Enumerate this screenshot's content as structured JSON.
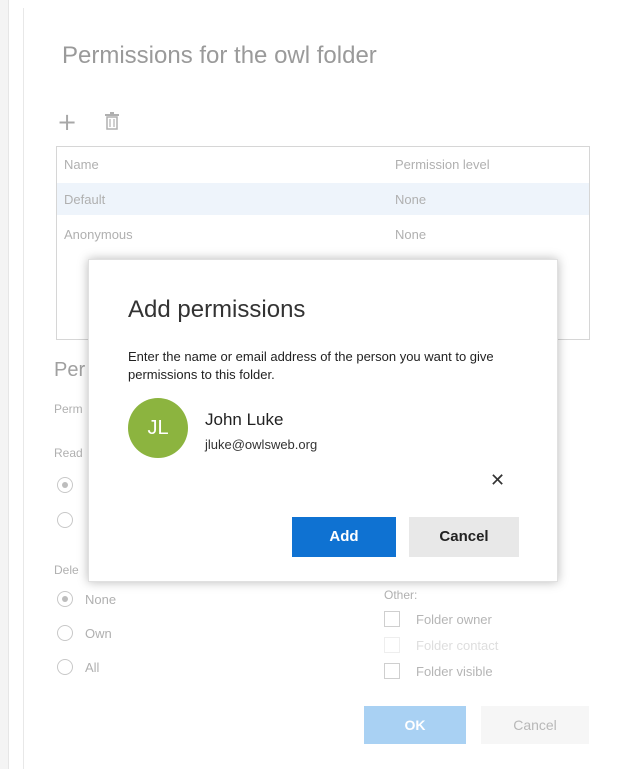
{
  "panel": {
    "title": "Permissions for the owl folder",
    "toolbar": {
      "add_icon": "plus-icon",
      "delete_icon": "trash-icon"
    },
    "table": {
      "headers": [
        "Name",
        "Permission level"
      ],
      "rows": [
        {
          "name": "Default",
          "level": "None",
          "selected": true
        },
        {
          "name": "Anonymous",
          "level": "None",
          "selected": false
        }
      ]
    },
    "section_heading": "Per",
    "permission_label": "Perm",
    "read_label": "Read",
    "delete_label": "Dele",
    "delete_options": [
      "None",
      "Own",
      "All"
    ],
    "delete_selected": "None",
    "other": {
      "label": "Other:",
      "items": [
        "Folder owner",
        "Folder contact",
        "Folder visible"
      ]
    },
    "ok_label": "OK",
    "cancel_label": "Cancel"
  },
  "dialog": {
    "title": "Add permissions",
    "description": "Enter the name or email address of the person you want to give permissions to this folder.",
    "person": {
      "initials": "JL",
      "name": "John Luke",
      "email": "jluke@owlsweb.org",
      "avatar_color": "#8cb43f"
    },
    "add_label": "Add",
    "cancel_label": "Cancel",
    "accent": "#0f72d2"
  }
}
